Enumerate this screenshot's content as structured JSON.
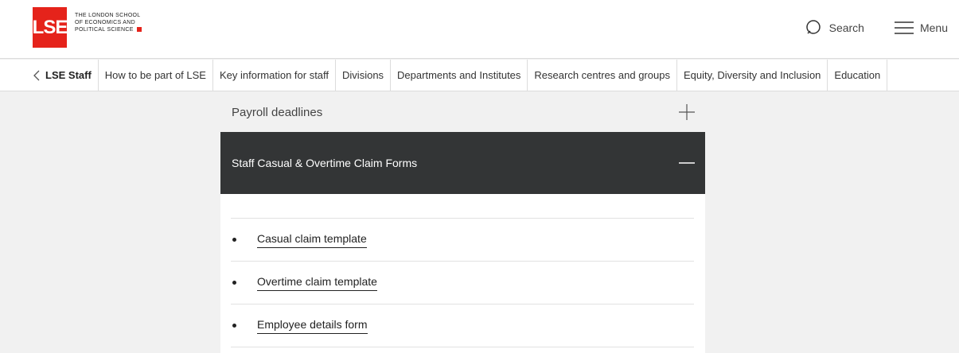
{
  "header": {
    "logo_mark": "LSE",
    "logo_line1": "The London School",
    "logo_line2": "of Economics and",
    "logo_line3": "Political Science",
    "search_label": "Search",
    "menu_label": "Menu"
  },
  "subnav": {
    "back_label": "LSE Staff",
    "items": [
      "How to be part of LSE",
      "Key information for staff",
      "Divisions",
      "Departments and Institutes",
      "Research centres and groups",
      "Equity, Diversity and Inclusion",
      "Education"
    ]
  },
  "accordion": {
    "collapsed_title": "Payroll deadlines",
    "expanded_title": "Staff Casual & Overtime Claim Forms",
    "links": [
      "Casual claim template",
      "Overtime claim template",
      "Employee details form"
    ]
  },
  "colors": {
    "brand_red": "#e5231b",
    "accordion_dark": "#333536",
    "page_bg": "#f1f1f1"
  }
}
